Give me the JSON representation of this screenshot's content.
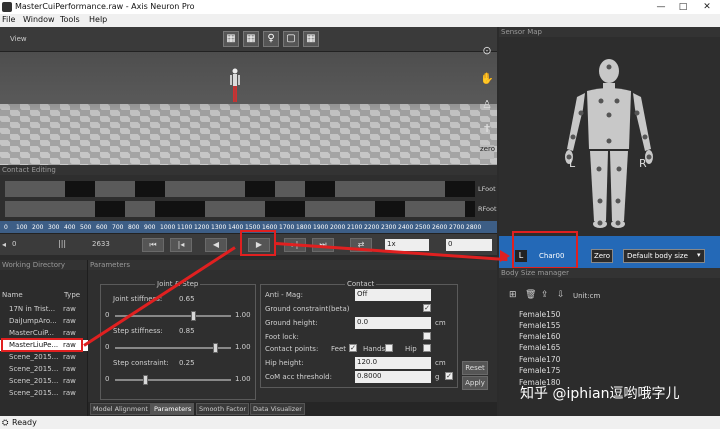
{
  "window": {
    "title": "MasterCuiPerformance.raw - Axis Neuron Pro",
    "controls": [
      "—",
      "□",
      "✕"
    ]
  },
  "menu": {
    "file": "File",
    "window": "Window",
    "tools": "Tools",
    "help": "Help"
  },
  "toolbar": {
    "view_label": "View"
  },
  "contact_editing": {
    "title": "Contact Editing",
    "track_left": "LFoot",
    "track_right": "RFoot"
  },
  "ruler": {
    "ticks": [
      "0",
      "100",
      "200",
      "300",
      "400",
      "500",
      "600",
      "700",
      "800",
      "900",
      "1000",
      "1100",
      "1200",
      "1300",
      "1400",
      "1500",
      "1600",
      "1700",
      "1800",
      "1900",
      "2000",
      "2100",
      "2200",
      "2300",
      "2400",
      "2500",
      "2600",
      "2700",
      "2800"
    ]
  },
  "playback": {
    "start": "0",
    "end": "2633",
    "speed": "1x",
    "frame": "0"
  },
  "working_directory": {
    "title": "Working Directory",
    "col_name": "Name",
    "col_type": "Type",
    "files": [
      {
        "name": "17N in Trist...",
        "type": "raw"
      },
      {
        "name": "DaiJumpAro...",
        "type": "raw"
      },
      {
        "name": "MasterCuiP...",
        "type": "raw"
      },
      {
        "name": "MasterLiuPe...",
        "type": "raw"
      },
      {
        "name": "Scene_2015...",
        "type": "raw"
      },
      {
        "name": "Scene_2015...",
        "type": "raw"
      },
      {
        "name": "Scene_2015...",
        "type": "raw"
      },
      {
        "name": "Scene_2015...",
        "type": "raw"
      }
    ]
  },
  "parameters": {
    "title": "Parameters",
    "joint_step_group": "Joint & Step",
    "joint_stiffness_label": "Joint stiffness:",
    "joint_stiffness_value": "0.65",
    "step_stiffness_label": "Step stiffness:",
    "step_stiffness_value": "0.85",
    "step_constraint_label": "Step constraint:",
    "step_constraint_value": "0.25",
    "min": "0",
    "max": "1.00",
    "contact_group": "Contact",
    "anti_mag_label": "Anti - Mag:",
    "anti_mag_value": "Off",
    "ground_constraint_label": "Ground constraint(beta)",
    "ground_height_label": "Ground height:",
    "ground_height_value": "0.0",
    "foot_lock_label": "Foot lock:",
    "contact_points_label": "Contact points:",
    "feet_label": "Feet",
    "hands_label": "Hands",
    "hip_label": "Hip",
    "hip_height_label": "Hip height:",
    "hip_height_value": "120.0",
    "com_label": "CoM acc threshold:",
    "com_value": "0.8000",
    "unit_cm": "cm",
    "unit_g": "g",
    "reset_label": "Reset",
    "apply_label": "Apply"
  },
  "tabs": [
    "Model Alignment",
    "Parameters",
    "Smooth Factor",
    "Data Visualizer"
  ],
  "sensor_map": {
    "title": "Sensor Map",
    "left": "L",
    "right": "R"
  },
  "body_bar": {
    "l_btn": "L",
    "char": "Char00",
    "zero_btn": "Zero",
    "body_size": "Default body size"
  },
  "body_size_manager": {
    "title": "Body Size manager",
    "unit_label": "Unit:cm",
    "items": [
      "Female150",
      "Female155",
      "Female160",
      "Female165",
      "Female170",
      "Female175",
      "Female180"
    ]
  },
  "status": "Ready",
  "watermark": "知乎 @iphian逗哟哦字儿",
  "colors": {
    "accent": "#2469b7",
    "annotation": "#e02020"
  }
}
